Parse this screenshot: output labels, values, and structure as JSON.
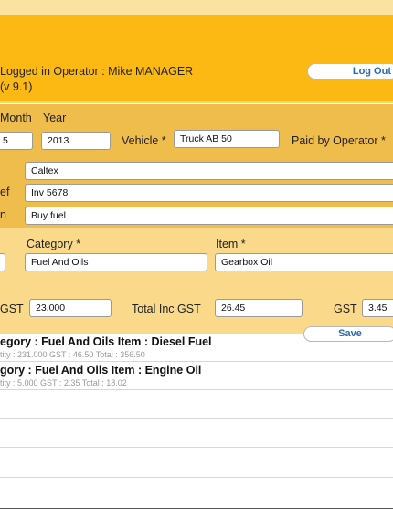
{
  "header": {
    "operator_line": "Logged in Operator : Mike MANAGER",
    "version": "(v 9.1)",
    "logout_label": "Log Out"
  },
  "form": {
    "month_label": "Month",
    "year_label": "Year",
    "month_value": "5",
    "year_value": "2013",
    "vehicle_label": "Vehicle *",
    "vehicle_value": "Truck AB 50",
    "paid_by_label": "Paid by Operator *",
    "supplier_value": "Caltex",
    "ref_label": "ef",
    "ref_value": "Inv 5678",
    "desc_label": "n",
    "desc_value": "Buy fuel",
    "category_label": "Category *",
    "category_value": "Fuel And Oils",
    "item_label": "Item *",
    "item_value": "Gearbox Oil",
    "ex_gst_label": "GST",
    "ex_gst_value": "23.000",
    "total_inc_label": "Total Inc GST",
    "total_inc_value": "26.45",
    "gst_label": "GST",
    "gst_value": "3.45",
    "save_label": "Save"
  },
  "entries": [
    {
      "title": "egory : Fuel And Oils Item : Diesel Fuel",
      "detail": "tity : 231.000   GST : 46.50   Total : 356.50"
    },
    {
      "title": "gory : Fuel And Oils Item : Engine Oil",
      "detail": "tity : 5.000   GST : 2.35   Total : 18.02"
    }
  ]
}
